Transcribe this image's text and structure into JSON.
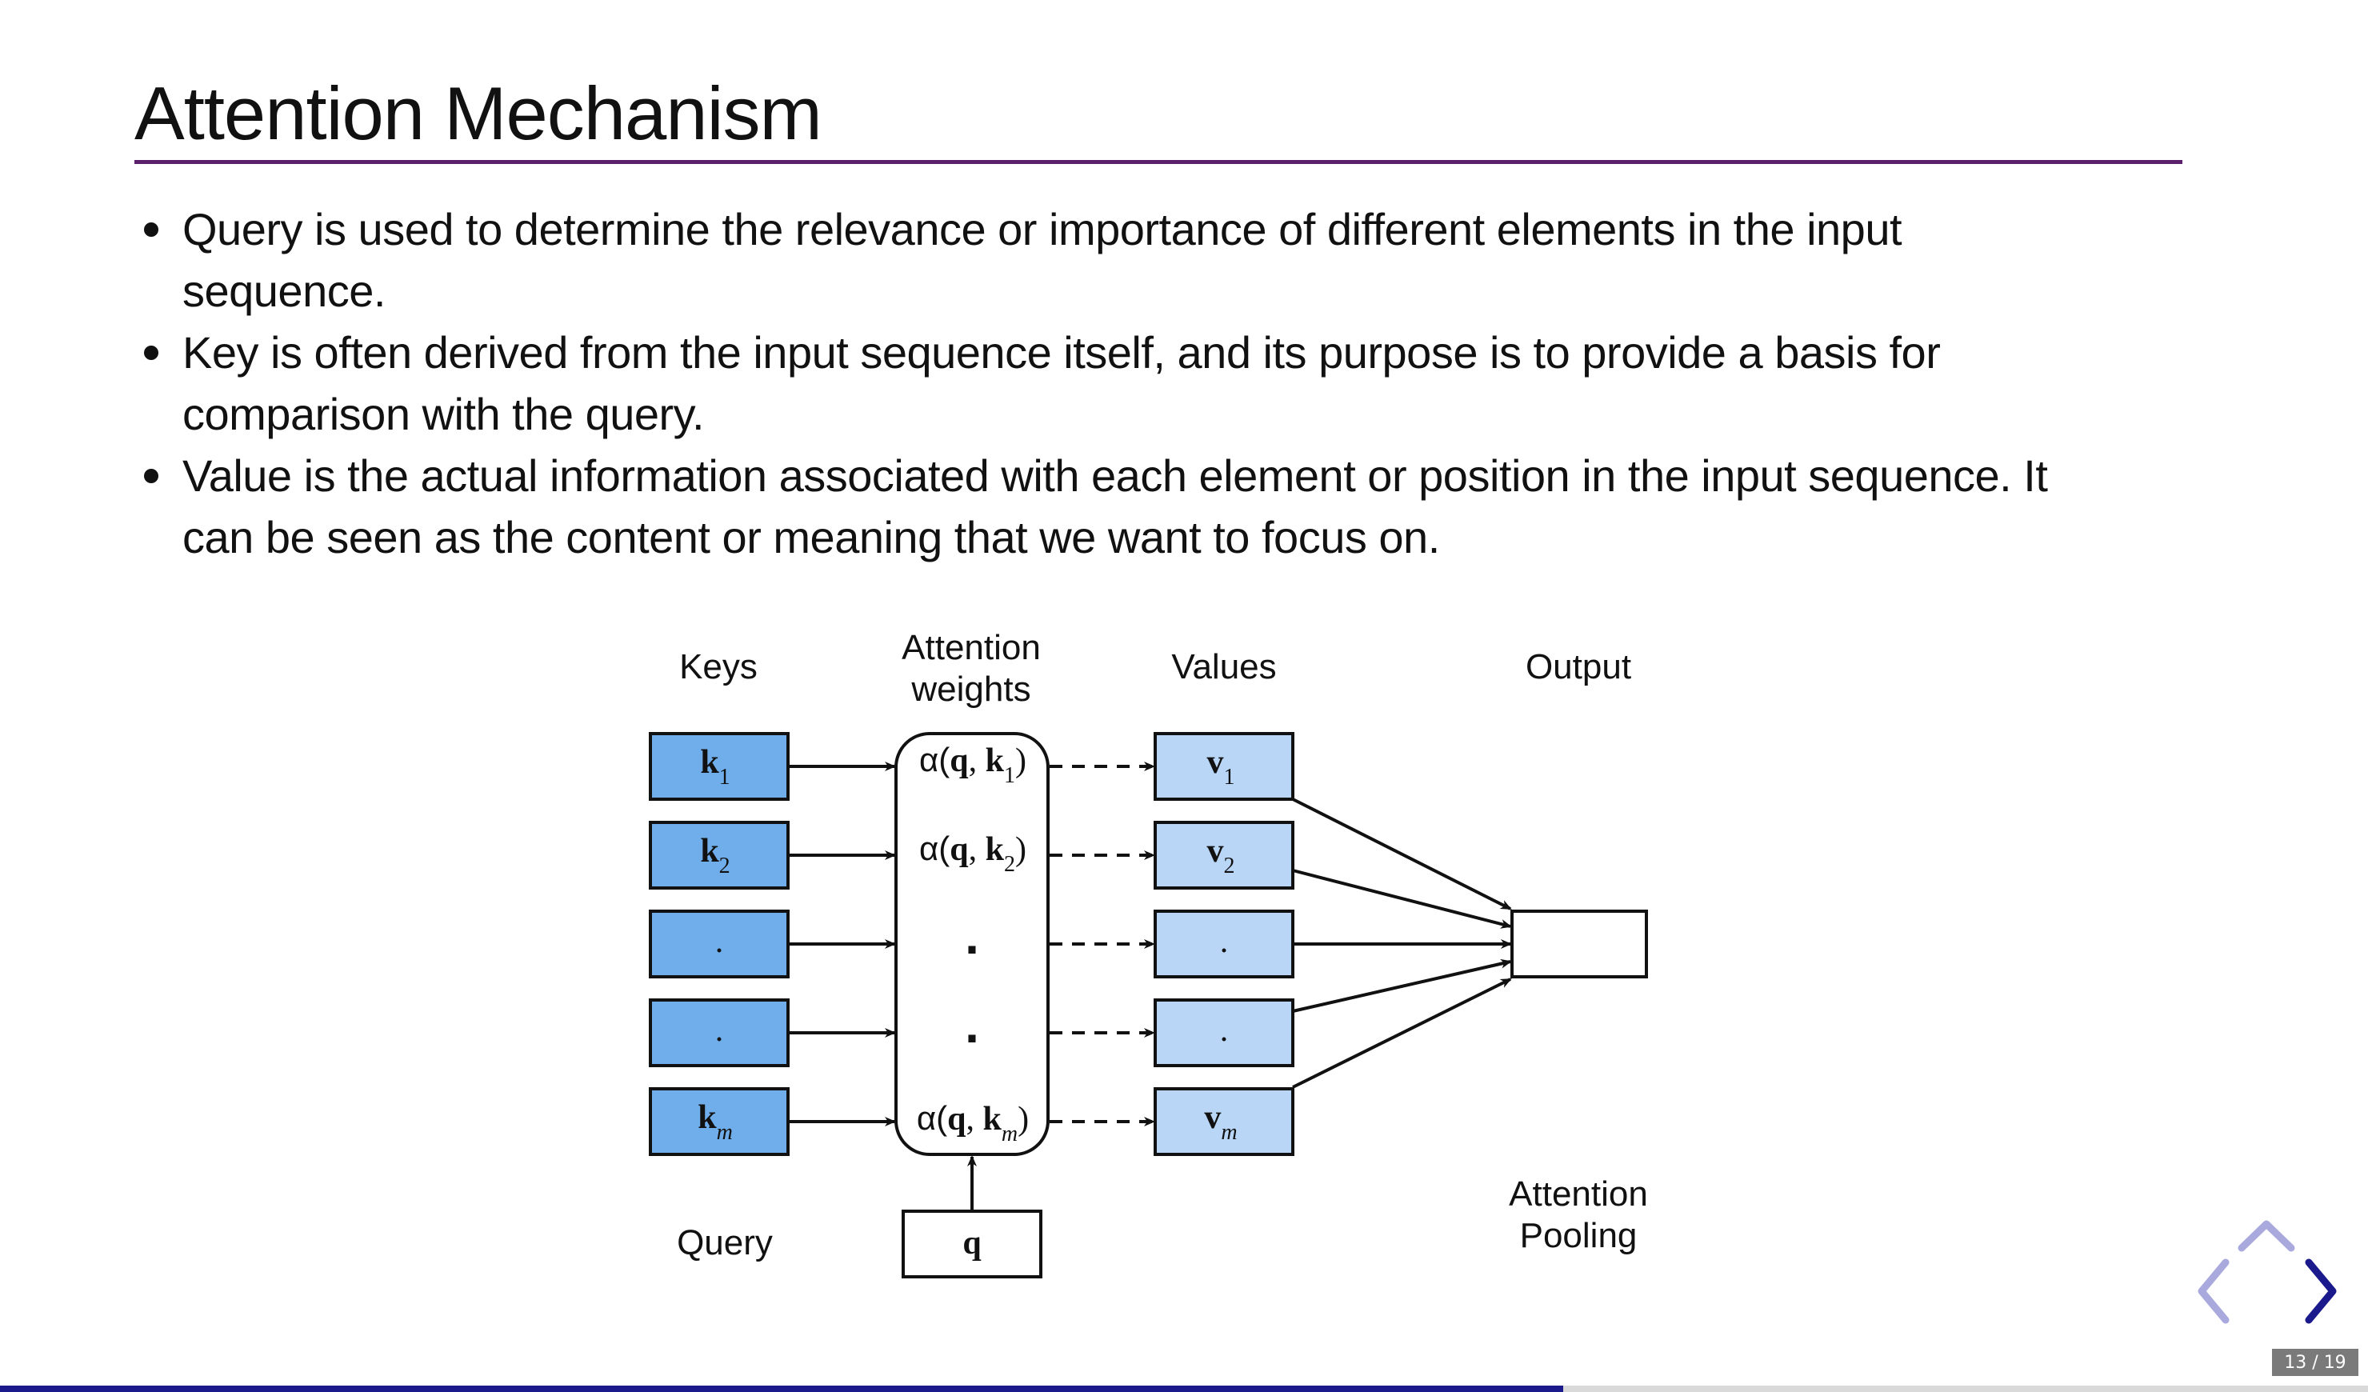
{
  "slide": {
    "title": "Attention Mechanism",
    "bullets": [
      [
        "Query is used to determine the relevance or importance of different elements in the input",
        "sequence."
      ],
      [
        "Key is often derived from the input sequence itself, and its purpose is to provide a basis for",
        "comparison with the query."
      ],
      [
        "Value is the actual information associated with each element or position in the input sequence. It",
        "can be seen as the content or meaning that we want to focus on."
      ]
    ]
  },
  "diagram": {
    "keys_label": "Keys",
    "weights_label": [
      "Attention",
      "weights"
    ],
    "values_label": "Values",
    "output_label": "Output",
    "query_label": "Query",
    "pooling_label": [
      "Attention",
      "Pooling"
    ],
    "query_symbol": "q",
    "keys": [
      {
        "base": "k",
        "sub": "1"
      },
      {
        "base": "k",
        "sub": "2"
      },
      {
        "base": ".",
        "sub": ""
      },
      {
        "base": ".",
        "sub": ""
      },
      {
        "base": "k",
        "sub": "m"
      }
    ],
    "weights": [
      {
        "alpha": "α(",
        "q": "q",
        "sep": ", ",
        "k": "k",
        "sub": "1",
        "close": ")"
      },
      {
        "alpha": "α(",
        "q": "q",
        "sep": ", ",
        "k": "k",
        "sub": "2",
        "close": ")"
      },
      {
        "dot": "."
      },
      {
        "dot": "."
      },
      {
        "alpha": "α(",
        "q": "q",
        "sep": ", ",
        "k": "k",
        "sub": "m",
        "close": ")"
      }
    ],
    "values": [
      {
        "base": "v",
        "sub": "1"
      },
      {
        "base": "v",
        "sub": "2"
      },
      {
        "base": ".",
        "sub": ""
      },
      {
        "base": ".",
        "sub": ""
      },
      {
        "base": "v",
        "sub": "m"
      }
    ],
    "colors": {
      "key_fill": "#6faeea",
      "value_fill": "#b9d6f7",
      "stroke": "#111111"
    }
  },
  "navigation": {
    "counter": "13 / 19",
    "current": 13,
    "total": 19,
    "progress_fraction": 0.66,
    "arrow_color_active": "#1a1a8c",
    "arrow_color_inactive": "#a9a9dd"
  }
}
